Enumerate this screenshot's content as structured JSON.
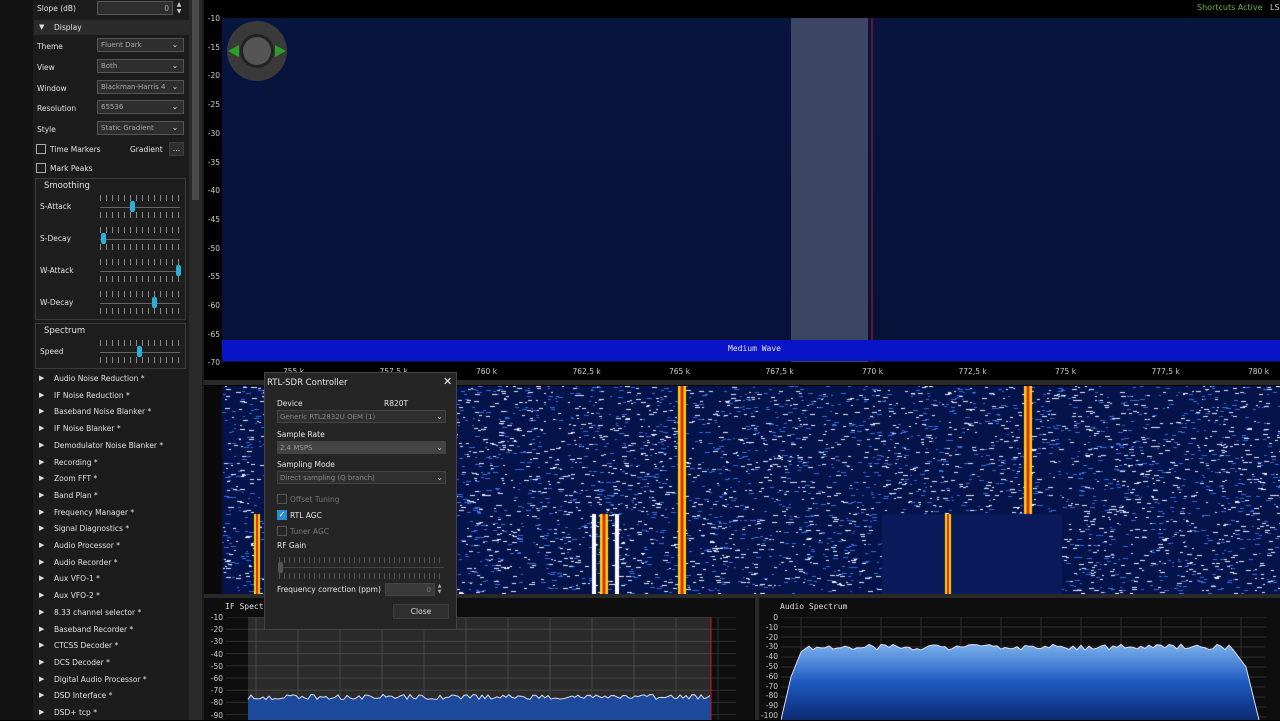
{
  "left_panel": {
    "slope_label": "Slope (dB)",
    "slope_value": "0",
    "display_header": "Display",
    "theme_label": "Theme",
    "theme_value": "Fluent Dark",
    "view_label": "View",
    "view_value": "Both",
    "window_label": "Window",
    "window_value": "Blackman-Harris 4",
    "resolution_label": "Resolution",
    "resolution_value": "65536",
    "style_label": "Style",
    "style_value": "Static Gradient",
    "time_markers_label": "Time Markers",
    "gradient_label": "Gradient",
    "gradient_button": "...",
    "mark_peaks_label": "Mark Peaks",
    "smoothing_title": "Smoothing",
    "s_attack_label": "S-Attack",
    "s_decay_label": "S-Decay",
    "w_attack_label": "W-Attack",
    "w_decay_label": "W-Decay",
    "spectrum_title": "Spectrum",
    "speed_label": "Speed",
    "plugins": [
      "Audio Noise Reduction *",
      "IF Noise Reduction *",
      "Baseband Noise Blanker *",
      "IF Noise Blanker *",
      "Demodulator Noise Blanker *",
      "Recording *",
      "Zoom FFT *",
      "Band Plan *",
      "Frequency Manager *",
      "Signal Diagnostics *",
      "Audio Processor *",
      "Audio Recorder *",
      "Aux VFO-1 *",
      "Aux VFO-2 *",
      "8.33 channel selector *",
      "Baseband Recorder *",
      "CTCSS Decoder *",
      "DCS Decoder *",
      "Digital Audio Processor *",
      "DSD Interface *",
      "DSD+ tcp *"
    ]
  },
  "header": {
    "shortcuts": "Shortcuts Active",
    "mode_partial": "LS"
  },
  "spectrum": {
    "y_ticks": [
      "-10",
      "-15",
      "-20",
      "-25",
      "-30",
      "-35",
      "-40",
      "-45",
      "-50",
      "-55",
      "-60",
      "-65",
      "-70"
    ],
    "x_ticks": [
      "755 k",
      "757,5 k",
      "760 k",
      "762,5 k",
      "765 k",
      "767,5 k",
      "770 k",
      "772,5 k",
      "775 k",
      "777,5 k",
      "780 k"
    ],
    "band_label": "Medium Wave",
    "color_fill": "#1a4fb0",
    "color_band": "#0a14c8"
  },
  "if_spectrum": {
    "title": "IF Spectrum",
    "y_ticks": [
      "-10",
      "-20",
      "-30",
      "-40",
      "-50",
      "-60",
      "-70",
      "-80",
      "-90"
    ]
  },
  "audio_spectrum": {
    "title": "Audio Spectrum",
    "y_ticks": [
      "0",
      "-10",
      "-20",
      "-30",
      "-40",
      "-50",
      "-60",
      "-70",
      "-80",
      "-90",
      "-100"
    ]
  },
  "dialog": {
    "title": "RTL-SDR Controller",
    "device_label": "Device",
    "tuner": "R820T",
    "device_value": "Generic RTL2832U OEM (1)",
    "sample_rate_label": "Sample Rate",
    "sample_rate_value": "2.4 MSPS",
    "sampling_mode_label": "Sampling Mode",
    "sampling_mode_value": "Direct sampling (Q branch)",
    "offset_tuning_label": "Offset Tuning",
    "rtl_agc_label": "RTL AGC",
    "tuner_agc_label": "Tuner AGC",
    "rf_gain_label": "RF Gain",
    "freq_corr_label": "Frequency correction (ppm)",
    "freq_corr_value": "0",
    "close_label": "Close"
  }
}
